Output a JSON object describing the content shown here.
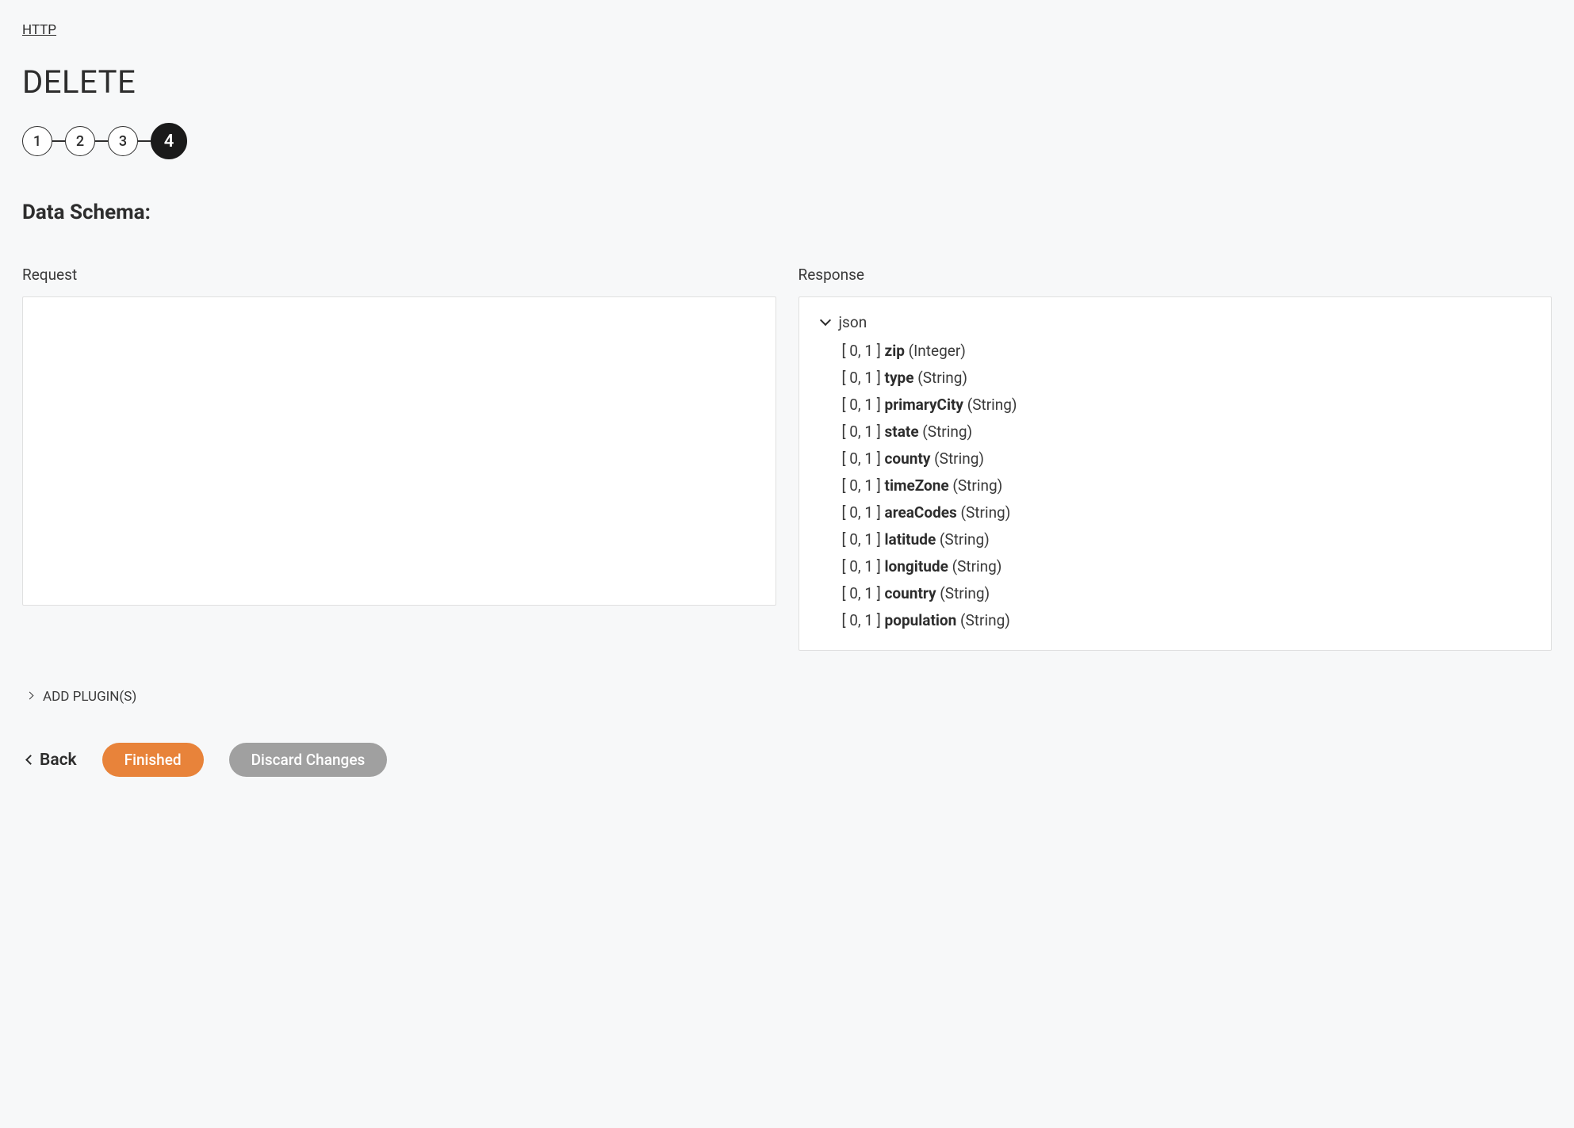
{
  "breadcrumb": {
    "label": "HTTP"
  },
  "page": {
    "title": "DELETE"
  },
  "stepper": {
    "steps": [
      "1",
      "2",
      "3",
      "4"
    ],
    "active_index": 3
  },
  "section": {
    "title": "Data Schema:"
  },
  "panels": {
    "request": {
      "label": "Request"
    },
    "response": {
      "label": "Response",
      "root_label": "json",
      "fields": [
        {
          "cardinality": "[ 0, 1 ]",
          "name": "zip",
          "type": "(Integer)"
        },
        {
          "cardinality": "[ 0, 1 ]",
          "name": "type",
          "type": "(String)"
        },
        {
          "cardinality": "[ 0, 1 ]",
          "name": "primaryCity",
          "type": "(String)"
        },
        {
          "cardinality": "[ 0, 1 ]",
          "name": "state",
          "type": "(String)"
        },
        {
          "cardinality": "[ 0, 1 ]",
          "name": "county",
          "type": "(String)"
        },
        {
          "cardinality": "[ 0, 1 ]",
          "name": "timeZone",
          "type": "(String)"
        },
        {
          "cardinality": "[ 0, 1 ]",
          "name": "areaCodes",
          "type": "(String)"
        },
        {
          "cardinality": "[ 0, 1 ]",
          "name": "latitude",
          "type": "(String)"
        },
        {
          "cardinality": "[ 0, 1 ]",
          "name": "longitude",
          "type": "(String)"
        },
        {
          "cardinality": "[ 0, 1 ]",
          "name": "country",
          "type": "(String)"
        },
        {
          "cardinality": "[ 0, 1 ]",
          "name": "population",
          "type": "(String)"
        }
      ]
    }
  },
  "add_plugins": {
    "label": "ADD PLUGIN(S)"
  },
  "footer": {
    "back_label": "Back",
    "finished_label": "Finished",
    "discard_label": "Discard Changes"
  }
}
